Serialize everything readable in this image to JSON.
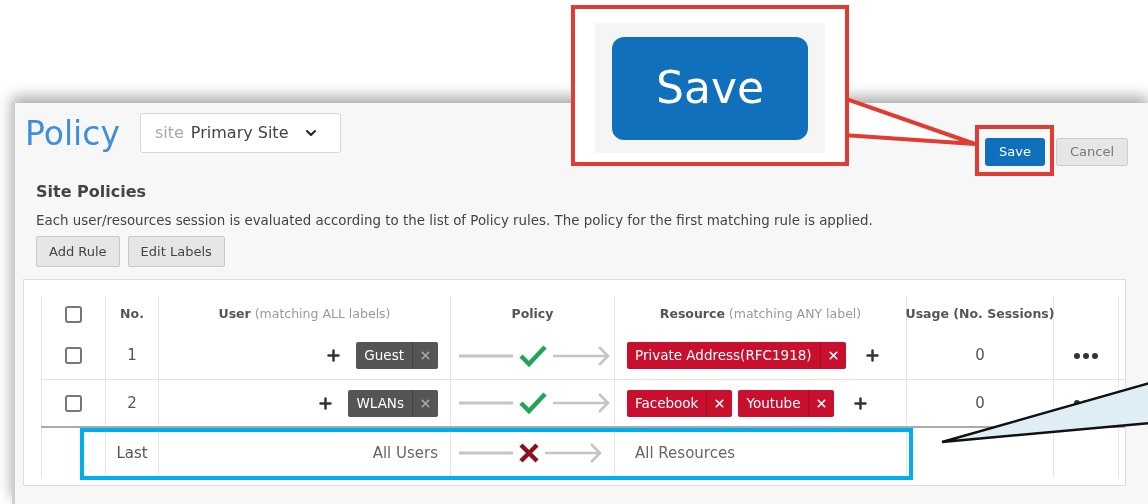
{
  "page": {
    "title": "Policy",
    "site_selector": {
      "prefix": "site",
      "value": "Primary Site"
    },
    "buttons": [
      {
        "label": "Save",
        "kind": "primary"
      },
      {
        "label": "Cancel",
        "kind": "secondary"
      }
    ]
  },
  "section": {
    "title": "Site Policies",
    "description": "Each user/resources session is evaluated according to the list of Policy rules. The policy for the first matching rule is applied.",
    "actions": [
      "Add Rule",
      "Edit Labels"
    ]
  },
  "table": {
    "header_checked": false,
    "columns": [
      {
        "label": "No."
      },
      {
        "label": "**User** (matching ALL labels)"
      },
      {
        "label": "Policy"
      },
      {
        "label": "**Resource** (matching ANY label)"
      },
      {
        "label": "Usage (No. Sessions)"
      }
    ],
    "rows": [
      {
        "kind": "rule",
        "checked": false,
        "no": "1",
        "user_labels": [
          "Guest"
        ],
        "allowed": true,
        "resource_labels": [
          "Private Address(RFC1918)"
        ],
        "usage": "0"
      },
      {
        "kind": "rule",
        "checked": false,
        "no": "2",
        "user_labels": [
          "WLANs"
        ],
        "allowed": true,
        "resource_labels": [
          "Facebook",
          "Youtube"
        ],
        "usage": "0"
      },
      {
        "kind": "default",
        "no": "Last",
        "user": "All Users",
        "allowed": false,
        "resource": "All Resources"
      }
    ]
  },
  "callout": {
    "label": "Save"
  }
}
